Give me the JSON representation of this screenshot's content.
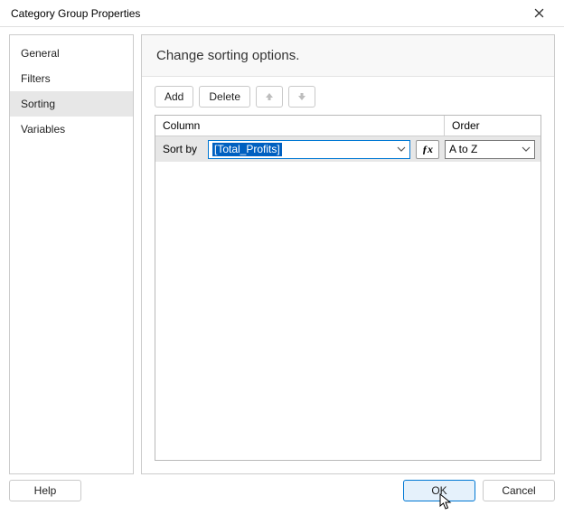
{
  "title": "Category Group Properties",
  "sidebar": {
    "items": [
      {
        "label": "General"
      },
      {
        "label": "Filters"
      },
      {
        "label": "Sorting"
      },
      {
        "label": "Variables"
      }
    ],
    "selected_index": 2
  },
  "main": {
    "heading": "Change sorting options.",
    "toolbar": {
      "add_label": "Add",
      "delete_label": "Delete"
    },
    "grid": {
      "headers": {
        "column": "Column",
        "order": "Order"
      },
      "row": {
        "label": "Sort by",
        "expression": "[Total_Profits]",
        "order": "A to Z"
      }
    }
  },
  "footer": {
    "help_label": "Help",
    "ok_label": "OK",
    "cancel_label": "Cancel"
  }
}
